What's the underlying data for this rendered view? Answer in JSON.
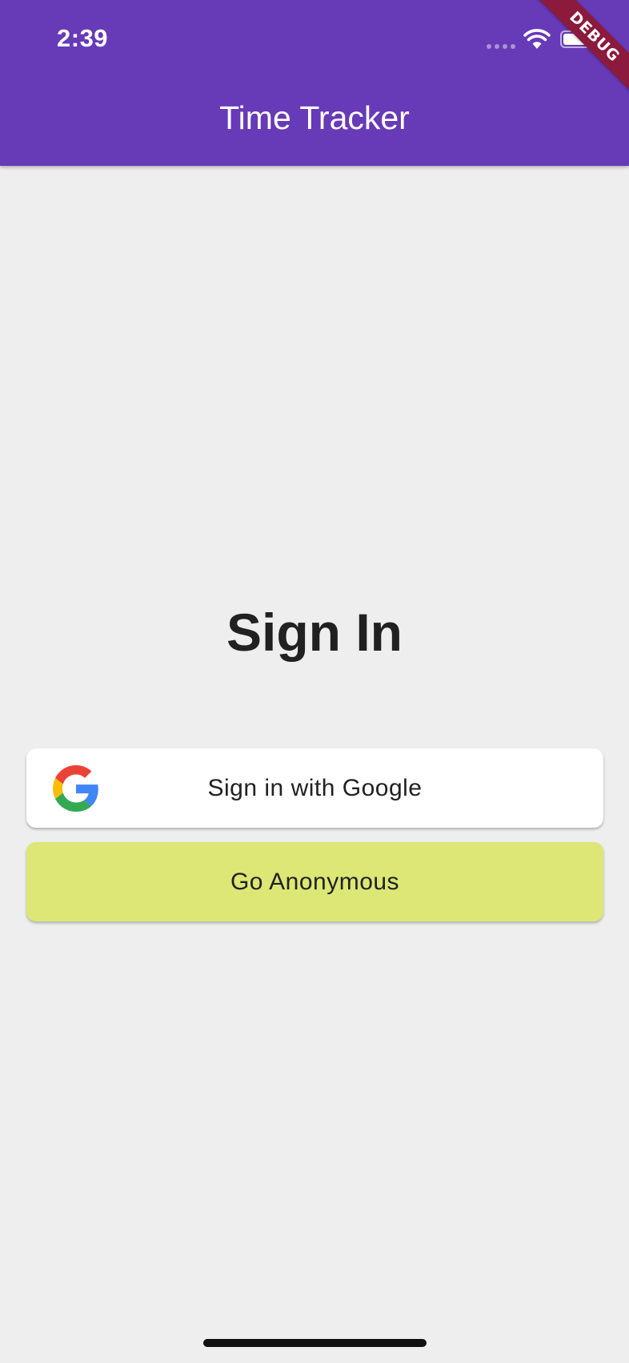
{
  "status_bar": {
    "time": "2:39"
  },
  "debug_banner": "DEBUG",
  "app_bar": {
    "title": "Time Tracker",
    "color": "#673ab7"
  },
  "main": {
    "heading": "Sign In",
    "google_button": {
      "label": "Sign in with Google",
      "icon": "google-logo-icon",
      "color": "#ffffff"
    },
    "anonymous_button": {
      "label": "Go Anonymous",
      "color": "#dce775"
    }
  },
  "colors": {
    "background": "#eeeeee",
    "text": "#212121"
  }
}
